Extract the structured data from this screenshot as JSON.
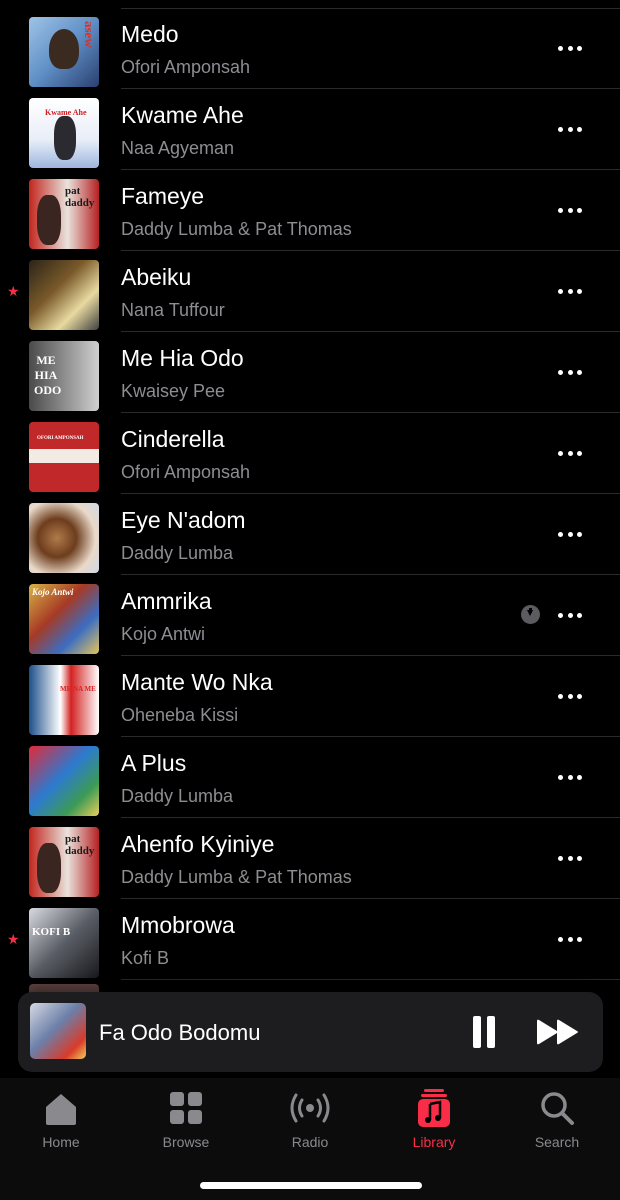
{
  "songs": [
    {
      "title": "Medo",
      "artist": "Ofori Amponsah",
      "starred": false,
      "downloaded": false,
      "art_text": "asew"
    },
    {
      "title": "Kwame Ahe",
      "artist": "Naa Agyeman",
      "starred": false,
      "downloaded": false,
      "art_text": "Kwame Ahe"
    },
    {
      "title": "Fameye",
      "artist": "Daddy Lumba & Pat Thomas",
      "starred": false,
      "downloaded": false,
      "art_text": "pat daddy"
    },
    {
      "title": "Abeiku",
      "artist": "Nana Tuffour",
      "starred": true,
      "downloaded": false,
      "art_text": ""
    },
    {
      "title": "Me Hia Odo",
      "artist": "Kwaisey Pee",
      "starred": false,
      "downloaded": false,
      "art_text": "ME HIA ODO"
    },
    {
      "title": "Cinderella",
      "artist": "Ofori Amponsah",
      "starred": false,
      "downloaded": false,
      "art_text": "OFORI AMPONSAH"
    },
    {
      "title": "Eye N'adom",
      "artist": "Daddy Lumba",
      "starred": false,
      "downloaded": false,
      "art_text": ""
    },
    {
      "title": "Ammrika",
      "artist": "Kojo Antwi",
      "starred": false,
      "downloaded": true,
      "art_text": "Kojo Antwi"
    },
    {
      "title": "Mante Wo Nka",
      "artist": "Oheneba Kissi",
      "starred": false,
      "downloaded": false,
      "art_text": "ME NA ME"
    },
    {
      "title": "A Plus",
      "artist": "Daddy Lumba",
      "starred": false,
      "downloaded": false,
      "art_text": ""
    },
    {
      "title": "Ahenfo Kyiniye",
      "artist": "Daddy Lumba & Pat Thomas",
      "starred": false,
      "downloaded": false,
      "art_text": "pat daddy"
    },
    {
      "title": "Mmobrowa",
      "artist": "Kofi B",
      "starred": true,
      "downloaded": false,
      "art_text": "KOFI B"
    }
  ],
  "icons": {
    "star": "star-icon",
    "more": "ellipsis-icon",
    "download": "download-icon"
  },
  "now_playing": {
    "title": "Fa Odo Bodomu"
  },
  "tabs": [
    {
      "label": "Home",
      "icon": "home-icon",
      "active": false
    },
    {
      "label": "Browse",
      "icon": "grid-icon",
      "active": false
    },
    {
      "label": "Radio",
      "icon": "radio-icon",
      "active": false
    },
    {
      "label": "Library",
      "icon": "library-icon",
      "active": true
    },
    {
      "label": "Search",
      "icon": "search-icon",
      "active": false
    }
  ],
  "colors": {
    "background": "#000000",
    "accent": "#fa2d48",
    "secondary_text": "#8d8d92",
    "mini_player_bg": "#1d1d1f"
  }
}
